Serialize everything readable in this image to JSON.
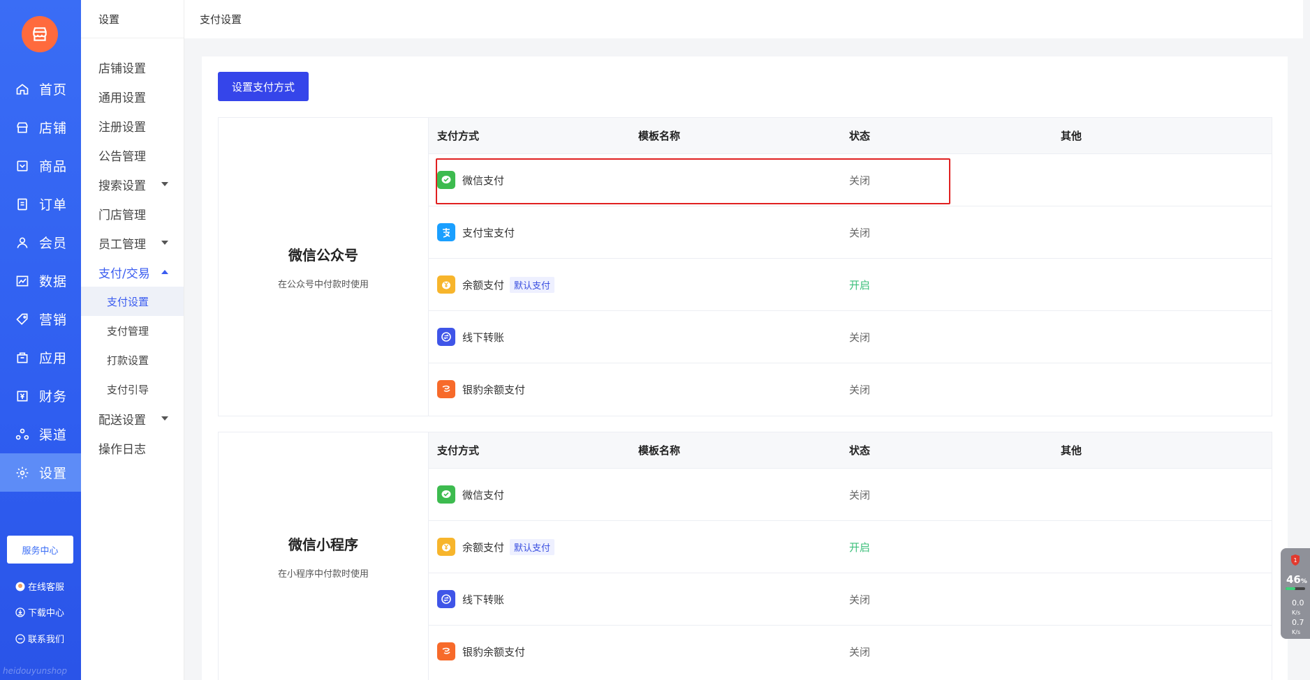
{
  "nav": {
    "items": [
      {
        "label": "首页",
        "icon": "home-icon"
      },
      {
        "label": "店铺",
        "icon": "store-icon"
      },
      {
        "label": "商品",
        "icon": "product-icon"
      },
      {
        "label": "订单",
        "icon": "order-icon"
      },
      {
        "label": "会员",
        "icon": "user-icon"
      },
      {
        "label": "数据",
        "icon": "chart-icon"
      },
      {
        "label": "营销",
        "icon": "tag-icon"
      },
      {
        "label": "应用",
        "icon": "app-icon"
      },
      {
        "label": "财务",
        "icon": "finance-icon"
      },
      {
        "label": "渠道",
        "icon": "channel-icon"
      },
      {
        "label": "设置",
        "icon": "gear-icon"
      }
    ],
    "service_center": "服务中心",
    "online_service": "在线客服",
    "download_center": "下载中心",
    "contact_us": "联系我们",
    "watermark": "heidouyunshop"
  },
  "subnav": {
    "title": "设置",
    "items": [
      "店铺设置",
      "通用设置",
      "注册设置",
      "公告管理",
      "搜索设置",
      "门店管理",
      "员工管理",
      "支付/交易"
    ],
    "children": [
      "支付设置",
      "支付管理",
      "打款设置",
      "支付引导"
    ],
    "after": [
      "配送设置",
      "操作日志"
    ]
  },
  "header": {
    "title": "支付设置"
  },
  "toolbar": {
    "set_payment_label": "设置支付方式"
  },
  "table_headers": [
    "支付方式",
    "模板名称",
    "状态",
    "其他"
  ],
  "groups": [
    {
      "title": "微信公众号",
      "desc": "在公众号中付款时使用",
      "rows": [
        {
          "name": "微信支付",
          "template": "",
          "status": "关闭",
          "badge": ""
        },
        {
          "name": "支付宝支付",
          "template": "",
          "status": "关闭",
          "badge": ""
        },
        {
          "name": "余额支付",
          "template": "",
          "status": "开启",
          "badge": "默认支付"
        },
        {
          "name": "线下转账",
          "template": "",
          "status": "关闭",
          "badge": ""
        },
        {
          "name": "银豹余额支付",
          "template": "",
          "status": "关闭",
          "badge": ""
        }
      ]
    },
    {
      "title": "微信小程序",
      "desc": "在小程序中付款时使用",
      "rows": [
        {
          "name": "微信支付",
          "template": "",
          "status": "关闭",
          "badge": ""
        },
        {
          "name": "余额支付",
          "template": "",
          "status": "开启",
          "badge": "默认支付"
        },
        {
          "name": "线下转账",
          "template": "",
          "status": "关闭",
          "badge": ""
        },
        {
          "name": "银豹余额支付",
          "template": "",
          "status": "关闭",
          "badge": ""
        }
      ]
    }
  ],
  "widget": {
    "percent": "46",
    "percent_unit": "%",
    "up": "0.0",
    "down": "0.7",
    "unit": "K/s",
    "alert": "1"
  },
  "colors": {
    "accent": "#3545ea",
    "nav": "#3a6df5",
    "on": "#3bbf7a",
    "highlight": "#e02020"
  }
}
